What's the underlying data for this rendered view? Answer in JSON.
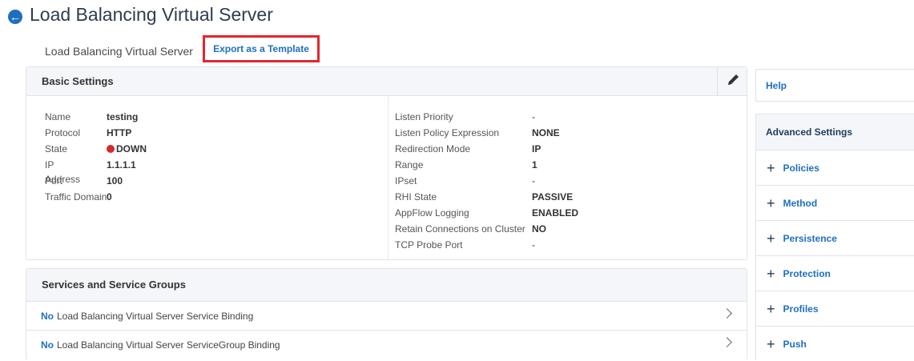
{
  "page": {
    "title": "Load Balancing Virtual Server",
    "breadcrumb": "Load Balancing Virtual Server",
    "export_link": "Export as a Template"
  },
  "basic_settings": {
    "title": "Basic Settings",
    "left": [
      {
        "label": "Name",
        "value": "testing"
      },
      {
        "label": "Protocol",
        "value": "HTTP"
      },
      {
        "label": "State",
        "value": "DOWN",
        "status_color": "#d42b2b"
      },
      {
        "label": "IP Address",
        "value": "1.1.1.1"
      },
      {
        "label": "Port",
        "value": "100"
      },
      {
        "label": "Traffic Domain",
        "value": "0"
      }
    ],
    "right": [
      {
        "label": "Listen Priority",
        "value": "-"
      },
      {
        "label": "Listen Policy Expression",
        "value": "NONE"
      },
      {
        "label": "Redirection Mode",
        "value": "IP"
      },
      {
        "label": "Range",
        "value": "1"
      },
      {
        "label": "IPset",
        "value": "-"
      },
      {
        "label": "RHI State",
        "value": "PASSIVE"
      },
      {
        "label": "AppFlow Logging",
        "value": "ENABLED"
      },
      {
        "label": "Retain Connections on Cluster",
        "value": "NO"
      },
      {
        "label": "TCP Probe Port",
        "value": "-"
      }
    ]
  },
  "services": {
    "title": "Services and Service Groups",
    "rows": [
      {
        "prefix": "No",
        "text": "Load Balancing Virtual Server Service Binding"
      },
      {
        "prefix": "No",
        "text": "Load Balancing Virtual Server ServiceGroup Binding"
      }
    ]
  },
  "sidebar": {
    "help": "Help",
    "advanced_title": "Advanced Settings",
    "items": [
      {
        "label": "Policies"
      },
      {
        "label": "Method"
      },
      {
        "label": "Persistence"
      },
      {
        "label": "Protection"
      },
      {
        "label": "Profiles"
      },
      {
        "label": "Push"
      }
    ]
  },
  "colors": {
    "accent": "#1f6fbf",
    "highlight_border": "#e3262f",
    "down": "#d42b2b"
  }
}
